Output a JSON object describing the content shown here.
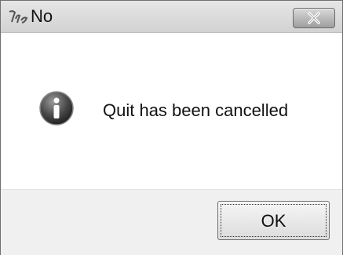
{
  "window": {
    "title": "No",
    "message": "Quit has been cancelled",
    "ok_label": "OK"
  },
  "icons": {
    "app": "app-logo-icon",
    "close": "close-icon",
    "info": "information-icon"
  }
}
